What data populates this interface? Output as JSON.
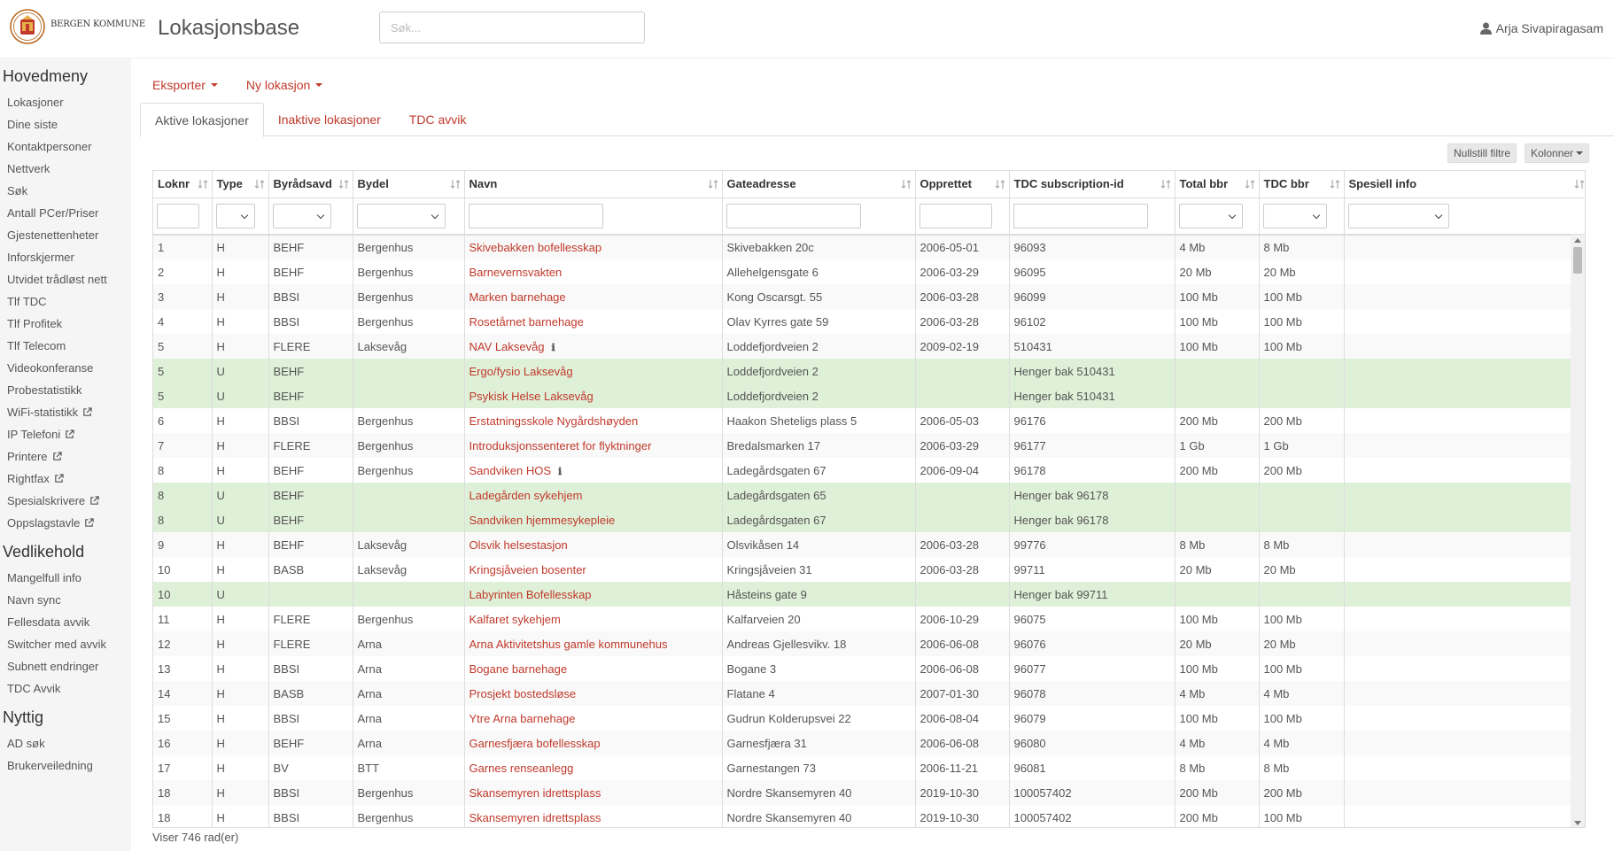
{
  "header": {
    "brand_text": "BERGEN KOMMUNE",
    "app_title": "Lokasjonsbase",
    "search_placeholder": "Søk...",
    "user_name": "Arja Sivapiragasam"
  },
  "sidebar": {
    "sections": [
      {
        "title": "Hovedmeny",
        "items": [
          {
            "label": "Lokasjoner",
            "external": false
          },
          {
            "label": "Dine siste",
            "external": false
          },
          {
            "label": "Kontaktpersoner",
            "external": false
          },
          {
            "label": "Nettverk",
            "external": false
          },
          {
            "label": "Søk",
            "external": false
          },
          {
            "label": "Antall PCer/Priser",
            "external": false
          },
          {
            "label": "Gjestenettenheter",
            "external": false
          },
          {
            "label": "Inforskjermer",
            "external": false
          },
          {
            "label": "Utvidet trådløst nett",
            "external": false
          },
          {
            "label": "Tlf TDC",
            "external": false
          },
          {
            "label": "Tlf Profitek",
            "external": false
          },
          {
            "label": "Tlf Telecom",
            "external": false
          },
          {
            "label": "Videokonferanse",
            "external": false
          },
          {
            "label": "Probestatistikk",
            "external": false
          },
          {
            "label": "WiFi-statistikk",
            "external": true
          },
          {
            "label": "IP Telefoni",
            "external": true
          },
          {
            "label": "Printere",
            "external": true
          },
          {
            "label": "Rightfax",
            "external": true
          },
          {
            "label": "Spesialskrivere",
            "external": true
          },
          {
            "label": "Oppslagstavle",
            "external": true
          }
        ]
      },
      {
        "title": "Vedlikehold",
        "items": [
          {
            "label": "Mangelfull info",
            "external": false
          },
          {
            "label": "Navn sync",
            "external": false
          },
          {
            "label": "Fellesdata avvik",
            "external": false
          },
          {
            "label": "Switcher med avvik",
            "external": false
          },
          {
            "label": "Subnett endringer",
            "external": false
          },
          {
            "label": "TDC Avvik",
            "external": false
          }
        ]
      },
      {
        "title": "Nyttig",
        "items": [
          {
            "label": "AD søk",
            "external": false
          },
          {
            "label": "Brukerveiledning",
            "external": false
          }
        ]
      }
    ]
  },
  "toolbar": {
    "export_label": "Eksporter",
    "new_label": "Ny lokasjon"
  },
  "tabs": [
    {
      "label": "Aktive lokasjoner",
      "active": true
    },
    {
      "label": "Inaktive lokasjoner",
      "active": false
    },
    {
      "label": "TDC avvik",
      "active": false
    }
  ],
  "buttons": {
    "reset_filters": "Nullstill filtre",
    "columns": "Kolonner"
  },
  "table": {
    "columns": [
      {
        "label": "Loknr",
        "filter": "input"
      },
      {
        "label": "Type",
        "filter": "select"
      },
      {
        "label": "Byrådsavd",
        "filter": "select"
      },
      {
        "label": "Bydel",
        "filter": "select"
      },
      {
        "label": "Navn",
        "filter": "input"
      },
      {
        "label": "Gateadresse",
        "filter": "input"
      },
      {
        "label": "Opprettet",
        "filter": "input"
      },
      {
        "label": "TDC subscription-id",
        "filter": "input"
      },
      {
        "label": "Total bbr",
        "filter": "select"
      },
      {
        "label": "TDC bbr",
        "filter": "select"
      },
      {
        "label": "Spesiell info",
        "filter": "select"
      }
    ],
    "rows": [
      {
        "c": [
          "1",
          "H",
          "BEHF",
          "Bergenhus",
          "Skivebakken bofellesskap",
          "Skivebakken 20c",
          "2006-05-01",
          "96093",
          "4 Mb",
          "8 Mb",
          ""
        ],
        "sub": false,
        "info": false
      },
      {
        "c": [
          "2",
          "H",
          "BEHF",
          "Bergenhus",
          "Barneverns­vakten",
          "Allehelgensgate 6",
          "2006-03-29",
          "96095",
          "20 Mb",
          "20 Mb",
          ""
        ],
        "sub": false,
        "info": false
      },
      {
        "c": [
          "3",
          "H",
          "BBSI",
          "Bergenhus",
          "Marken barnehage",
          "Kong Oscarsgt. 55",
          "2006-03-28",
          "96099",
          "100 Mb",
          "100 Mb",
          ""
        ],
        "sub": false,
        "info": false
      },
      {
        "c": [
          "4",
          "H",
          "BBSI",
          "Bergenhus",
          "Rosetårnet barnehage",
          "Olav Kyrres gate 59",
          "2006-03-28",
          "96102",
          "100 Mb",
          "100 Mb",
          ""
        ],
        "sub": false,
        "info": false
      },
      {
        "c": [
          "5",
          "H",
          "FLERE",
          "Laksevåg",
          "NAV Laksevåg",
          "Loddefjordveien 2",
          "2009-02-19",
          "510431",
          "100 Mb",
          "100 Mb",
          ""
        ],
        "sub": false,
        "info": true
      },
      {
        "c": [
          "5",
          "U",
          "BEHF",
          "",
          "Ergo/fysio Laksevåg",
          "Loddefjordveien 2",
          "",
          "Henger bak 510431",
          "",
          "",
          ""
        ],
        "sub": true,
        "info": false
      },
      {
        "c": [
          "5",
          "U",
          "BEHF",
          "",
          "Psykisk Helse Laksevåg",
          "Loddefjordveien 2",
          "",
          "Henger bak 510431",
          "",
          "",
          ""
        ],
        "sub": true,
        "info": false
      },
      {
        "c": [
          "6",
          "H",
          "BBSI",
          "Bergenhus",
          "Erstatningsskole Nygårdshøyden",
          "Haakon Sheteligs plass 5",
          "2006-05-03",
          "96176",
          "200 Mb",
          "200 Mb",
          ""
        ],
        "sub": false,
        "info": false
      },
      {
        "c": [
          "7",
          "H",
          "FLERE",
          "Bergenhus",
          "Introduksjonssenteret for flyktninger",
          "Bredalsmarken 17",
          "2006-03-29",
          "96177",
          "1 Gb",
          "1 Gb",
          ""
        ],
        "sub": false,
        "info": false
      },
      {
        "c": [
          "8",
          "H",
          "BEHF",
          "Bergenhus",
          "Sandviken HOS",
          "Ladegårdsgaten 67",
          "2006-09-04",
          "96178",
          "200 Mb",
          "200 Mb",
          ""
        ],
        "sub": false,
        "info": true
      },
      {
        "c": [
          "8",
          "U",
          "BEHF",
          "",
          "Ladegården sykehjem",
          "Ladegårdsgaten 65",
          "",
          "Henger bak 96178",
          "",
          "",
          ""
        ],
        "sub": true,
        "info": false
      },
      {
        "c": [
          "8",
          "U",
          "BEHF",
          "",
          "Sandviken hjemmesykepleie",
          "Ladegårdsgaten 67",
          "",
          "Henger bak 96178",
          "",
          "",
          ""
        ],
        "sub": true,
        "info": false
      },
      {
        "c": [
          "9",
          "H",
          "BEHF",
          "Laksevåg",
          "Olsvik helsestasjon",
          "Olsvikåsen 14",
          "2006-03-28",
          "99776",
          "8 Mb",
          "8 Mb",
          ""
        ],
        "sub": false,
        "info": false
      },
      {
        "c": [
          "10",
          "H",
          "BASB",
          "Laksevåg",
          "Kringsjåveien bosenter",
          "Kringsjåveien 31",
          "2006-03-28",
          "99711",
          "20 Mb",
          "20 Mb",
          ""
        ],
        "sub": false,
        "info": false
      },
      {
        "c": [
          "10",
          "U",
          "",
          "",
          "Labyrinten Bofellesskap",
          "Håsteins gate 9",
          "",
          "Henger bak 99711",
          "",
          "",
          ""
        ],
        "sub": true,
        "info": false
      },
      {
        "c": [
          "11",
          "H",
          "FLERE",
          "Bergenhus",
          "Kalfaret sykehjem",
          "Kalfarveien 20",
          "2006-10-29",
          "96075",
          "100 Mb",
          "100 Mb",
          ""
        ],
        "sub": false,
        "info": false
      },
      {
        "c": [
          "12",
          "H",
          "FLERE",
          "Arna",
          "Arna Aktivitetshus gamle kommunehus",
          "Andreas Gjellesvikv. 18",
          "2006-06-08",
          "96076",
          "20 Mb",
          "20 Mb",
          ""
        ],
        "sub": false,
        "info": false
      },
      {
        "c": [
          "13",
          "H",
          "BBSI",
          "Arna",
          "Bogane barnehage",
          "Bogane 3",
          "2006-06-08",
          "96077",
          "100 Mb",
          "100 Mb",
          ""
        ],
        "sub": false,
        "info": false
      },
      {
        "c": [
          "14",
          "H",
          "BASB",
          "Arna",
          "Prosjekt bostedsløse",
          "Flatane 4",
          "2007-01-30",
          "96078",
          "4 Mb",
          "4 Mb",
          ""
        ],
        "sub": false,
        "info": false
      },
      {
        "c": [
          "15",
          "H",
          "BBSI",
          "Arna",
          "Ytre Arna barnehage",
          "Gudrun Kolderupsvei 22",
          "2006-08-04",
          "96079",
          "100 Mb",
          "100 Mb",
          ""
        ],
        "sub": false,
        "info": false
      },
      {
        "c": [
          "16",
          "H",
          "BEHF",
          "Arna",
          "Garnesfjæra bofellesskap",
          "Garnesfjæra 31",
          "2006-06-08",
          "96080",
          "4 Mb",
          "4 Mb",
          ""
        ],
        "sub": false,
        "info": false
      },
      {
        "c": [
          "17",
          "H",
          "BV",
          "BTT",
          "Garnes renseanlegg",
          "Garnestangen 73",
          "2006-11-21",
          "96081",
          "8 Mb",
          "8 Mb",
          ""
        ],
        "sub": false,
        "info": false
      },
      {
        "c": [
          "18",
          "H",
          "BBSI",
          "Bergenhus",
          "Skansemyren idrettsplass",
          "Nordre Skansemyren 40",
          "2019-10-30",
          "100057402",
          "200 Mb",
          "200 Mb",
          ""
        ],
        "sub": false,
        "info": false
      },
      {
        "c": [
          "18",
          "H",
          "BBSI",
          "Bergenhus",
          "Skansemyren idrettsplass",
          "Nordre Skansemyren 40",
          "2019-10-30",
          "100057402",
          "200 Mb",
          "100 Mb",
          ""
        ],
        "sub": false,
        "info": false
      }
    ],
    "footer": "Viser 746 rad(er)"
  },
  "colors": {
    "link": "#c0392b",
    "sub_row": "#dff0d8",
    "sidebar_bg": "#f5f5f5"
  }
}
